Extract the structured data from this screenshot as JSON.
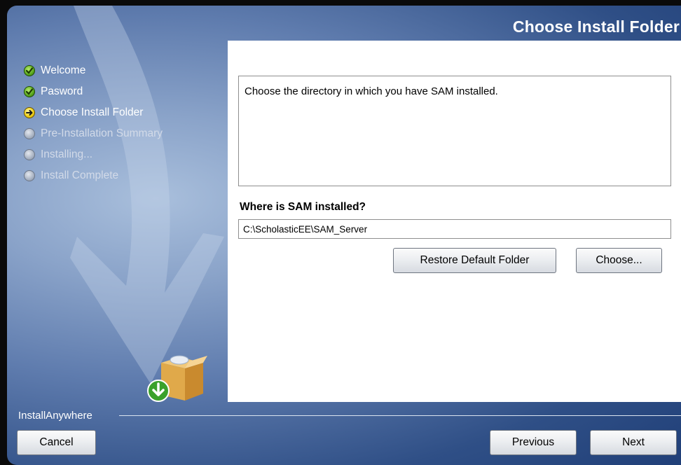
{
  "header": {
    "title": "Choose Install Folder"
  },
  "steps": [
    {
      "label": "Welcome",
      "state": "done",
      "icon": "check-icon"
    },
    {
      "label": "Pasword",
      "state": "done",
      "icon": "check-icon"
    },
    {
      "label": "Choose Install Folder",
      "state": "current",
      "icon": "arrow-right-icon"
    },
    {
      "label": "Pre-Installation Summary",
      "state": "pending",
      "icon": "circle-icon"
    },
    {
      "label": "Installing...",
      "state": "pending",
      "icon": "circle-icon"
    },
    {
      "label": "Install Complete",
      "state": "pending",
      "icon": "circle-icon"
    }
  ],
  "content": {
    "message": "Choose the directory in which you have SAM installed.",
    "where_label": "Where is SAM installed?",
    "folder_value": "C:\\ScholasticEE\\SAM_Server",
    "restore_label": "Restore Default Folder",
    "choose_label": "Choose..."
  },
  "footer": {
    "brand": "InstallAnywhere",
    "cancel_label": "Cancel",
    "previous_label": "Previous",
    "next_label": "Next"
  },
  "colors": {
    "sidebar_blue": "#5f7cae",
    "step_done": "#5aa81e",
    "step_current": "#f2d31a",
    "step_pending": "#a8b2c2"
  }
}
